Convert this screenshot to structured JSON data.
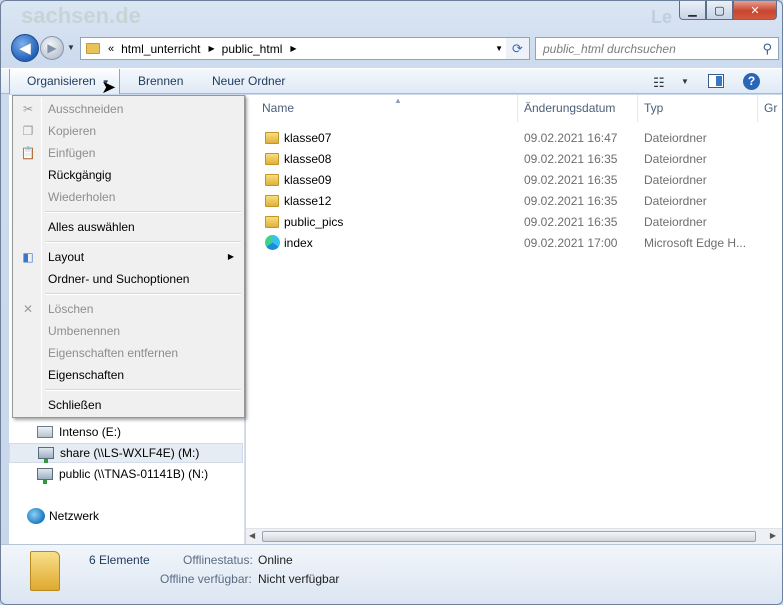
{
  "window": {
    "watermark_left": "sachsen.de",
    "watermark_right": "Le",
    "controls": {
      "minimize": "▁",
      "maximize": "▢",
      "close": "✕"
    }
  },
  "address": {
    "chevron": "«",
    "segments": [
      "html_unterricht",
      "public_html"
    ],
    "search_placeholder": "public_html durchsuchen"
  },
  "toolbar": {
    "organize_label": "Organisieren",
    "burn_label": "Brennen",
    "new_folder_label": "Neuer Ordner"
  },
  "menu": {
    "items": [
      {
        "label": "Ausschneiden",
        "enabled": false,
        "icon": "scissors-icon"
      },
      {
        "label": "Kopieren",
        "enabled": false,
        "icon": "copy-icon"
      },
      {
        "label": "Einfügen",
        "enabled": false,
        "icon": "paste-icon"
      },
      {
        "label": "Rückgängig",
        "enabled": true
      },
      {
        "label": "Wiederholen",
        "enabled": false
      },
      {
        "label": "Alles auswählen",
        "enabled": true
      },
      {
        "label": "Layout",
        "enabled": true,
        "icon": "layout-icon",
        "submenu": true
      },
      {
        "label": "Ordner- und Suchoptionen",
        "enabled": true
      },
      {
        "label": "Löschen",
        "enabled": false,
        "icon": "delete-icon"
      },
      {
        "label": "Umbenennen",
        "enabled": false
      },
      {
        "label": "Eigenschaften entfernen",
        "enabled": false
      },
      {
        "label": "Eigenschaften",
        "enabled": true
      },
      {
        "label": "Schließen",
        "enabled": true
      }
    ]
  },
  "nav": {
    "drives": [
      {
        "label": "Intenso (E:)",
        "type": "drive-icon"
      },
      {
        "label": "share (\\\\LS-WXLF4E) (M:)",
        "type": "network-drive-icon",
        "selected": true
      },
      {
        "label": "public (\\\\TNAS-01141B) (N:)",
        "type": "network-drive-icon"
      }
    ],
    "network_label": "Netzwerk"
  },
  "columns": {
    "name": "Name",
    "date": "Änderungsdatum",
    "type": "Typ",
    "size": "Gr"
  },
  "files": [
    {
      "name": "klasse07",
      "date": "09.02.2021 16:47",
      "type": "Dateiordner",
      "icon": "folder-icon"
    },
    {
      "name": "klasse08",
      "date": "09.02.2021 16:35",
      "type": "Dateiordner",
      "icon": "folder-icon"
    },
    {
      "name": "klasse09",
      "date": "09.02.2021 16:35",
      "type": "Dateiordner",
      "icon": "folder-icon"
    },
    {
      "name": "klasse12",
      "date": "09.02.2021 16:35",
      "type": "Dateiordner",
      "icon": "folder-icon"
    },
    {
      "name": "public_pics",
      "date": "09.02.2021 16:35",
      "type": "Dateiordner",
      "icon": "folder-icon"
    },
    {
      "name": "index",
      "date": "09.02.2021 17:00",
      "type": "Microsoft Edge H...",
      "icon": "edge-icon"
    }
  ],
  "details": {
    "count": "6 Elemente",
    "offline_status_label": "Offlinestatus:",
    "offline_status_value": "Online",
    "offline_available_label": "Offline verfügbar:",
    "offline_available_value": "Nicht verfügbar"
  }
}
